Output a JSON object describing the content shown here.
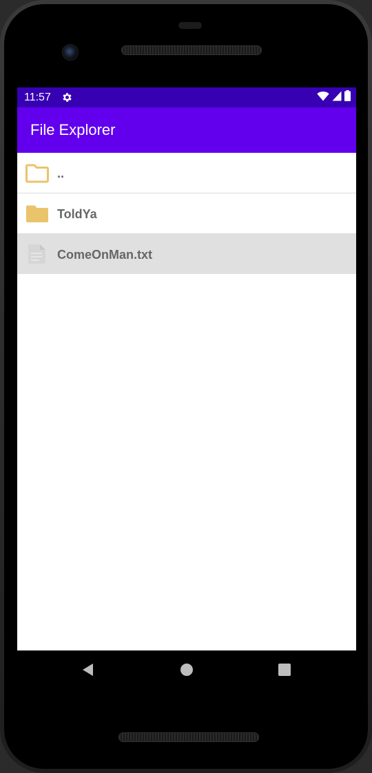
{
  "status_bar": {
    "time": "11:57",
    "icons": [
      "settings-gear-icon",
      "wifi-icon",
      "cellular-signal-icon",
      "battery-icon"
    ]
  },
  "app_bar": {
    "title": "File Explorer"
  },
  "file_list": {
    "items": [
      {
        "name": "..",
        "icon": "folder-outline-icon",
        "selected": false
      },
      {
        "name": "ToldYa",
        "icon": "folder-filled-icon",
        "selected": false
      },
      {
        "name": "ComeOnMan.txt",
        "icon": "document-icon",
        "selected": true
      }
    ]
  },
  "nav_bar": {
    "buttons": [
      "back-icon",
      "home-icon",
      "recents-icon"
    ]
  },
  "colors": {
    "status_bar": "#3700b3",
    "app_bar": "#6200ee",
    "folder": "#e9c46a",
    "selected_row": "#e0e0e0",
    "file_text": "#666666"
  }
}
